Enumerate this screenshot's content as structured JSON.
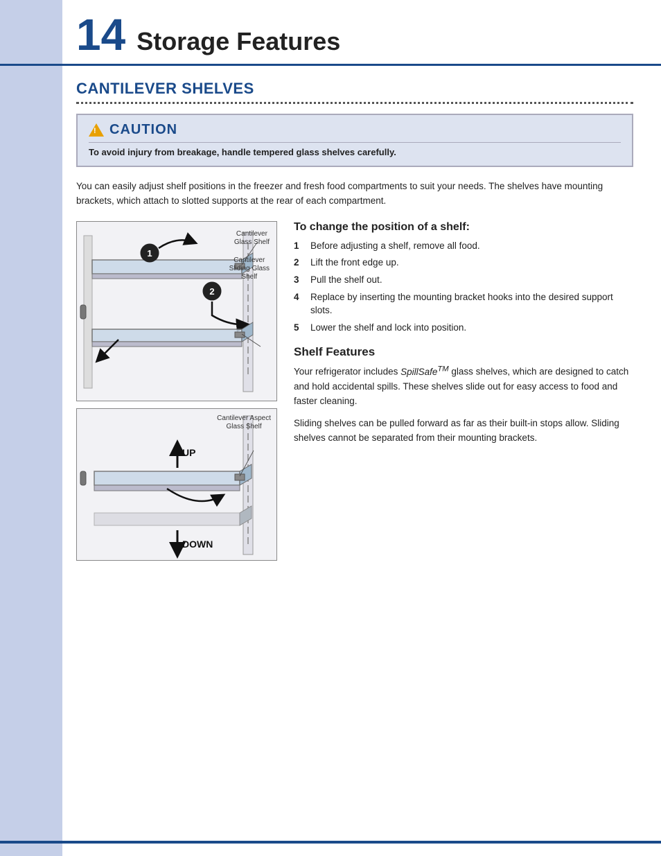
{
  "chapter": {
    "number": "14",
    "title": "Storage Features"
  },
  "section": {
    "title": "CANTILEVER SHELVES"
  },
  "caution": {
    "label": "CAUTION",
    "text": "To avoid  injury from breakage, handle tempered glass shelves carefully."
  },
  "body_paragraph": "You can easily adjust shelf positions in the freezer and fresh food compartments to suit your needs. The shelves have mounting brackets, which attach to slotted supports at the rear of each compartment.",
  "subheading_change": "To change the position of a shelf:",
  "steps": [
    {
      "number": "1",
      "text": "Before adjusting a shelf, remove all food."
    },
    {
      "number": "2",
      "text": "Lift the front edge up."
    },
    {
      "number": "3",
      "text": "Pull the shelf out."
    },
    {
      "number": "4",
      "text": "Replace by inserting the mounting bracket hooks into the desired support slots."
    },
    {
      "number": "5",
      "text": "Lower the shelf and lock into position."
    }
  ],
  "subheading_features": "Shelf Features",
  "shelf_para1": "Your refrigerator includes SpillSafe™ glass shelves, which are designed to catch and hold accidental spills. These shelves slide out for easy access to food and faster cleaning.",
  "shelf_para2": "Sliding shelves can be pulled forward as far as their built-in stops allow. Sliding shelves cannot be separated from their mounting brackets.",
  "diagram_upper": {
    "label1": "Cantilever\nGlass Shelf",
    "label2": "Cantilever\nSliding Glass\nShelf",
    "num1": "1",
    "num2": "2"
  },
  "diagram_lower": {
    "label1": "Cantilever Aspect\nGlass Shelf",
    "up_label": "UP",
    "down_label": "DOWN"
  },
  "spillsafe_tm": "TM"
}
